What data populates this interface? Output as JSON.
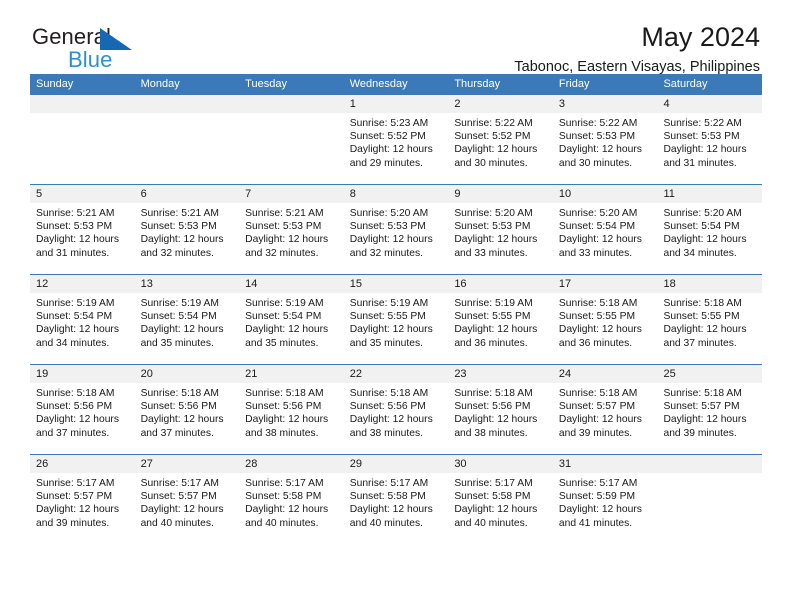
{
  "brand": {
    "name_part1": "General",
    "name_part2": "Blue",
    "triangle_color": "#1668b3",
    "blue_text_color": "#2d8fd5"
  },
  "header": {
    "title": "May 2024",
    "subtitle": "Tabonoc, Eastern Visayas, Philippines",
    "header_bg_color": "#3b79b8",
    "datenum_bg_color": "#f1f1f1"
  },
  "weekdays": [
    "Sunday",
    "Monday",
    "Tuesday",
    "Wednesday",
    "Thursday",
    "Friday",
    "Saturday"
  ],
  "labels": {
    "sunrise_prefix": "Sunrise:",
    "sunset_prefix": "Sunset:",
    "daylight_prefix": "Daylight:"
  },
  "weeks": [
    [
      {
        "day": "",
        "empty": true,
        "line1": "",
        "line2": "",
        "line3": "",
        "line4": ""
      },
      {
        "day": "",
        "empty": true,
        "line1": "",
        "line2": "",
        "line3": "",
        "line4": ""
      },
      {
        "day": "",
        "empty": true,
        "line1": "",
        "line2": "",
        "line3": "",
        "line4": ""
      },
      {
        "day": "1",
        "empty": false,
        "line1": "Sunrise: 5:23 AM",
        "line2": "Sunset: 5:52 PM",
        "line3": "Daylight: 12 hours",
        "line4": "and 29 minutes."
      },
      {
        "day": "2",
        "empty": false,
        "line1": "Sunrise: 5:22 AM",
        "line2": "Sunset: 5:52 PM",
        "line3": "Daylight: 12 hours",
        "line4": "and 30 minutes."
      },
      {
        "day": "3",
        "empty": false,
        "line1": "Sunrise: 5:22 AM",
        "line2": "Sunset: 5:53 PM",
        "line3": "Daylight: 12 hours",
        "line4": "and 30 minutes."
      },
      {
        "day": "4",
        "empty": false,
        "line1": "Sunrise: 5:22 AM",
        "line2": "Sunset: 5:53 PM",
        "line3": "Daylight: 12 hours",
        "line4": "and 31 minutes."
      }
    ],
    [
      {
        "day": "5",
        "empty": false,
        "line1": "Sunrise: 5:21 AM",
        "line2": "Sunset: 5:53 PM",
        "line3": "Daylight: 12 hours",
        "line4": "and 31 minutes."
      },
      {
        "day": "6",
        "empty": false,
        "line1": "Sunrise: 5:21 AM",
        "line2": "Sunset: 5:53 PM",
        "line3": "Daylight: 12 hours",
        "line4": "and 32 minutes."
      },
      {
        "day": "7",
        "empty": false,
        "line1": "Sunrise: 5:21 AM",
        "line2": "Sunset: 5:53 PM",
        "line3": "Daylight: 12 hours",
        "line4": "and 32 minutes."
      },
      {
        "day": "8",
        "empty": false,
        "line1": "Sunrise: 5:20 AM",
        "line2": "Sunset: 5:53 PM",
        "line3": "Daylight: 12 hours",
        "line4": "and 32 minutes."
      },
      {
        "day": "9",
        "empty": false,
        "line1": "Sunrise: 5:20 AM",
        "line2": "Sunset: 5:53 PM",
        "line3": "Daylight: 12 hours",
        "line4": "and 33 minutes."
      },
      {
        "day": "10",
        "empty": false,
        "line1": "Sunrise: 5:20 AM",
        "line2": "Sunset: 5:54 PM",
        "line3": "Daylight: 12 hours",
        "line4": "and 33 minutes."
      },
      {
        "day": "11",
        "empty": false,
        "line1": "Sunrise: 5:20 AM",
        "line2": "Sunset: 5:54 PM",
        "line3": "Daylight: 12 hours",
        "line4": "and 34 minutes."
      }
    ],
    [
      {
        "day": "12",
        "empty": false,
        "line1": "Sunrise: 5:19 AM",
        "line2": "Sunset: 5:54 PM",
        "line3": "Daylight: 12 hours",
        "line4": "and 34 minutes."
      },
      {
        "day": "13",
        "empty": false,
        "line1": "Sunrise: 5:19 AM",
        "line2": "Sunset: 5:54 PM",
        "line3": "Daylight: 12 hours",
        "line4": "and 35 minutes."
      },
      {
        "day": "14",
        "empty": false,
        "line1": "Sunrise: 5:19 AM",
        "line2": "Sunset: 5:54 PM",
        "line3": "Daylight: 12 hours",
        "line4": "and 35 minutes."
      },
      {
        "day": "15",
        "empty": false,
        "line1": "Sunrise: 5:19 AM",
        "line2": "Sunset: 5:55 PM",
        "line3": "Daylight: 12 hours",
        "line4": "and 35 minutes."
      },
      {
        "day": "16",
        "empty": false,
        "line1": "Sunrise: 5:19 AM",
        "line2": "Sunset: 5:55 PM",
        "line3": "Daylight: 12 hours",
        "line4": "and 36 minutes."
      },
      {
        "day": "17",
        "empty": false,
        "line1": "Sunrise: 5:18 AM",
        "line2": "Sunset: 5:55 PM",
        "line3": "Daylight: 12 hours",
        "line4": "and 36 minutes."
      },
      {
        "day": "18",
        "empty": false,
        "line1": "Sunrise: 5:18 AM",
        "line2": "Sunset: 5:55 PM",
        "line3": "Daylight: 12 hours",
        "line4": "and 37 minutes."
      }
    ],
    [
      {
        "day": "19",
        "empty": false,
        "line1": "Sunrise: 5:18 AM",
        "line2": "Sunset: 5:56 PM",
        "line3": "Daylight: 12 hours",
        "line4": "and 37 minutes."
      },
      {
        "day": "20",
        "empty": false,
        "line1": "Sunrise: 5:18 AM",
        "line2": "Sunset: 5:56 PM",
        "line3": "Daylight: 12 hours",
        "line4": "and 37 minutes."
      },
      {
        "day": "21",
        "empty": false,
        "line1": "Sunrise: 5:18 AM",
        "line2": "Sunset: 5:56 PM",
        "line3": "Daylight: 12 hours",
        "line4": "and 38 minutes."
      },
      {
        "day": "22",
        "empty": false,
        "line1": "Sunrise: 5:18 AM",
        "line2": "Sunset: 5:56 PM",
        "line3": "Daylight: 12 hours",
        "line4": "and 38 minutes."
      },
      {
        "day": "23",
        "empty": false,
        "line1": "Sunrise: 5:18 AM",
        "line2": "Sunset: 5:56 PM",
        "line3": "Daylight: 12 hours",
        "line4": "and 38 minutes."
      },
      {
        "day": "24",
        "empty": false,
        "line1": "Sunrise: 5:18 AM",
        "line2": "Sunset: 5:57 PM",
        "line3": "Daylight: 12 hours",
        "line4": "and 39 minutes."
      },
      {
        "day": "25",
        "empty": false,
        "line1": "Sunrise: 5:18 AM",
        "line2": "Sunset: 5:57 PM",
        "line3": "Daylight: 12 hours",
        "line4": "and 39 minutes."
      }
    ],
    [
      {
        "day": "26",
        "empty": false,
        "line1": "Sunrise: 5:17 AM",
        "line2": "Sunset: 5:57 PM",
        "line3": "Daylight: 12 hours",
        "line4": "and 39 minutes."
      },
      {
        "day": "27",
        "empty": false,
        "line1": "Sunrise: 5:17 AM",
        "line2": "Sunset: 5:57 PM",
        "line3": "Daylight: 12 hours",
        "line4": "and 40 minutes."
      },
      {
        "day": "28",
        "empty": false,
        "line1": "Sunrise: 5:17 AM",
        "line2": "Sunset: 5:58 PM",
        "line3": "Daylight: 12 hours",
        "line4": "and 40 minutes."
      },
      {
        "day": "29",
        "empty": false,
        "line1": "Sunrise: 5:17 AM",
        "line2": "Sunset: 5:58 PM",
        "line3": "Daylight: 12 hours",
        "line4": "and 40 minutes."
      },
      {
        "day": "30",
        "empty": false,
        "line1": "Sunrise: 5:17 AM",
        "line2": "Sunset: 5:58 PM",
        "line3": "Daylight: 12 hours",
        "line4": "and 40 minutes."
      },
      {
        "day": "31",
        "empty": false,
        "line1": "Sunrise: 5:17 AM",
        "line2": "Sunset: 5:59 PM",
        "line3": "Daylight: 12 hours",
        "line4": "and 41 minutes."
      },
      {
        "day": "",
        "empty": true,
        "line1": "",
        "line2": "",
        "line3": "",
        "line4": ""
      }
    ]
  ]
}
